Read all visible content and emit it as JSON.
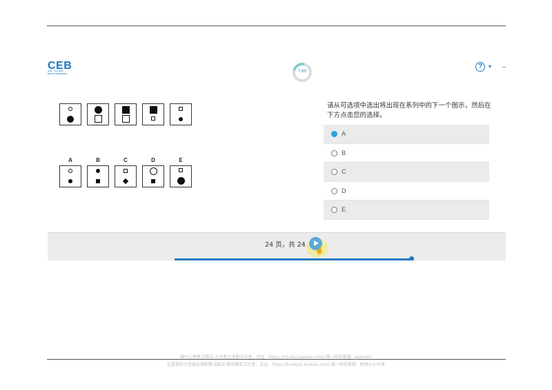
{
  "header": {
    "logo_text": "CEB",
    "logo_subtitle": "SHL TALENT MEASUREMENT",
    "timer_value": "7.00",
    "help_icon": "?",
    "dropdown_caret": "▾",
    "edge_icon": "→"
  },
  "puzzle": {
    "option_labels": [
      "A",
      "B",
      "C",
      "D",
      "E"
    ]
  },
  "question": {
    "text": "请从可选项中选出将出现在系列中的下一个图示，然后在下方点击您的选择。"
  },
  "options": [
    {
      "label": "A",
      "selected": true
    },
    {
      "label": "B",
      "selected": false
    },
    {
      "label": "C",
      "selected": false
    },
    {
      "label": "D",
      "selected": false
    },
    {
      "label": "E",
      "selected": false
    }
  ],
  "navigation": {
    "page_text": "24 页，共 24",
    "progress_fraction": 0.94
  },
  "footer": {
    "line1": "做什么职笔试面试-大大职上求职工作室，店址：https://51jobs.taobao.com/ 唯一旺旺客服：gelerpin",
    "line2": "这是保险大型国企测职笔试面试-职场精英工作室，店址：https://huntjob.taobao.com/ 唯一旺旺客服：职场小小大使"
  },
  "colors": {
    "brand": "#1e78be",
    "selected_radio": "#2d9fe0",
    "next_button": "#5aa9d6"
  }
}
